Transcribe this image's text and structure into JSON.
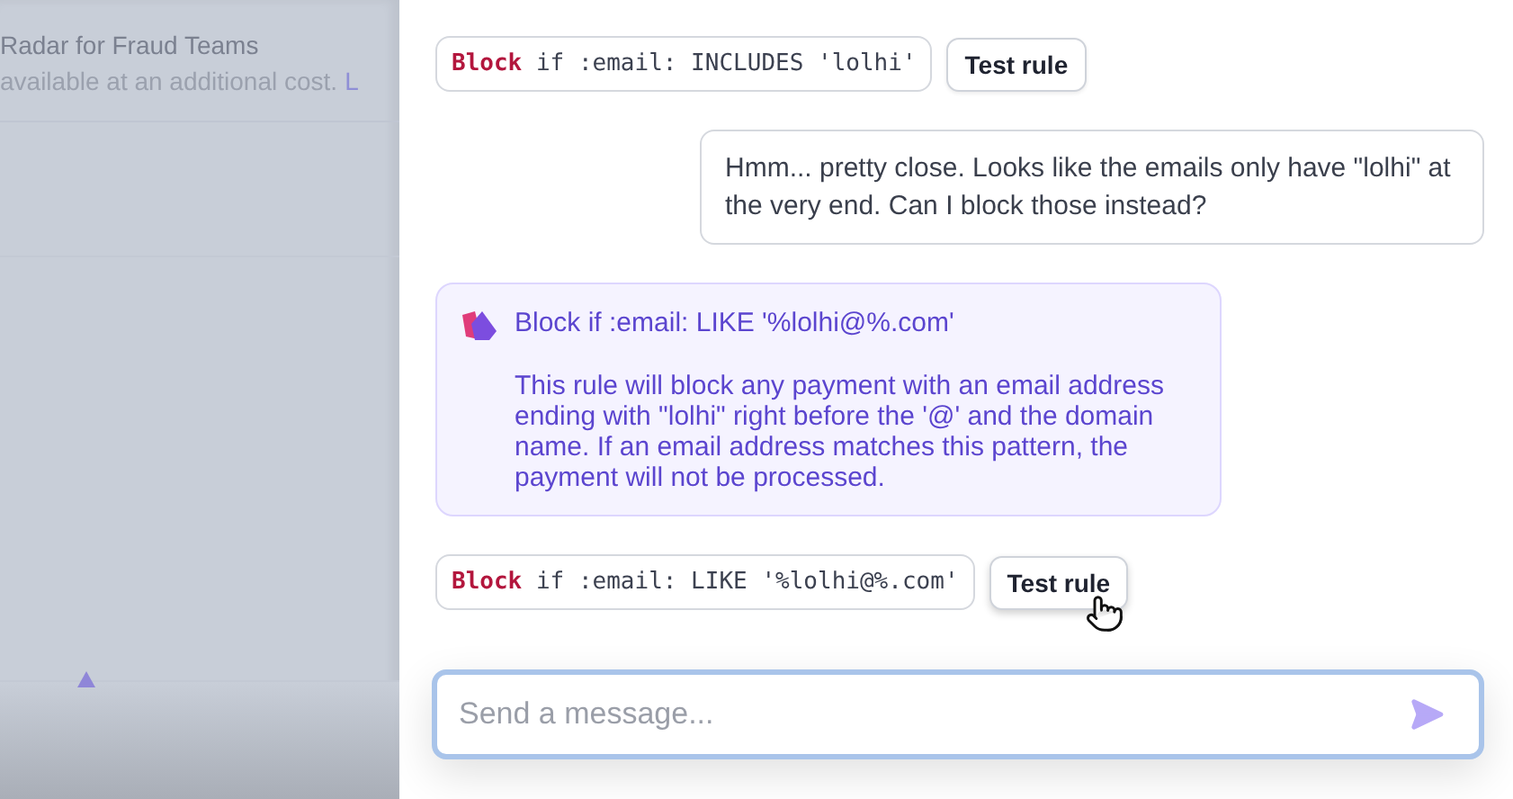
{
  "sidebar": {
    "title": "Radar for Fraud Teams",
    "description": "available at an additional cost.",
    "link": "L"
  },
  "messages": [
    {
      "kind": "rule",
      "action": "Block",
      "condition": "if :email: INCLUDES 'lolhi'",
      "button": "Test rule",
      "hovered": false
    },
    {
      "kind": "user",
      "text": "Hmm... pretty close. Looks like the emails only have \"lolhi\" at the very end. Can I block those instead?"
    },
    {
      "kind": "assistant",
      "title": "Block if :email: LIKE '%lolhi@%.com'",
      "text": "This rule will block any payment with an email address ending with \"lolhi\" right before the '@' and the domain name. If an email address matches this pattern, the payment will not be processed."
    },
    {
      "kind": "rule",
      "action": "Block",
      "condition": "if :email: LIKE '%lolhi@%.com'",
      "button": "Test rule",
      "hovered": true
    }
  ],
  "composer": {
    "placeholder": "Send a message..."
  }
}
